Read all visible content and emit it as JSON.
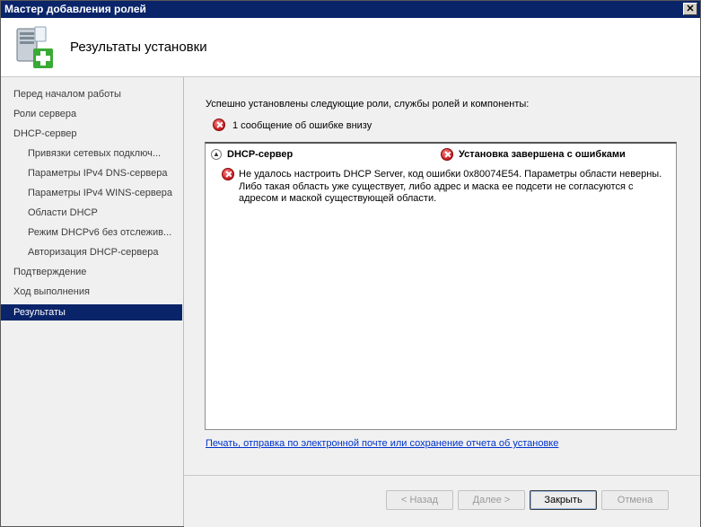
{
  "window": {
    "title": "Мастер добавления ролей",
    "close_label": "✕"
  },
  "header": {
    "title": "Результаты установки",
    "icon": "server-add-icon"
  },
  "sidebar": {
    "items": [
      {
        "label": "Перед началом работы",
        "level": "top"
      },
      {
        "label": "Роли сервера",
        "level": "top"
      },
      {
        "label": "DHCP-сервер",
        "level": "top"
      },
      {
        "label": "Привязки сетевых подключ...",
        "level": "sub"
      },
      {
        "label": "Параметры IPv4 DNS-сервера",
        "level": "sub"
      },
      {
        "label": "Параметры IPv4 WINS-сервера",
        "level": "sub"
      },
      {
        "label": "Области DHCP",
        "level": "sub"
      },
      {
        "label": "Режим DHCPv6 без отслежив...",
        "level": "sub"
      },
      {
        "label": "Авторизация DHCP-сервера",
        "level": "sub"
      },
      {
        "label": "Подтверждение",
        "level": "top"
      },
      {
        "label": "Ход выполнения",
        "level": "top"
      },
      {
        "label": "Результаты",
        "level": "top",
        "active": true
      }
    ]
  },
  "main": {
    "intro": "Успешно установлены следующие роли, службы ролей и компоненты:",
    "error_summary": "1 сообщение об ошибке внизу",
    "result": {
      "role": "DHCP-сервер",
      "status": "Установка завершена с ошибками",
      "message": "Не удалось настроить DHCP Server, код ошибки 0x80074E54.  Параметры области неверны. Либо такая область уже существует,  либо адрес и маска ее подсети не согласуются с адресом и маской  существующей области."
    },
    "report_link": "Печать, отправка по электронной почте или сохранение отчета об установке"
  },
  "footer": {
    "back": "< Назад",
    "next": "Далее >",
    "close": "Закрыть",
    "cancel": "Отмена"
  },
  "colors": {
    "titlebar": "#0a246a",
    "active_nav": "#0a246a",
    "link": "#0033cc",
    "error": "#c4161c"
  }
}
